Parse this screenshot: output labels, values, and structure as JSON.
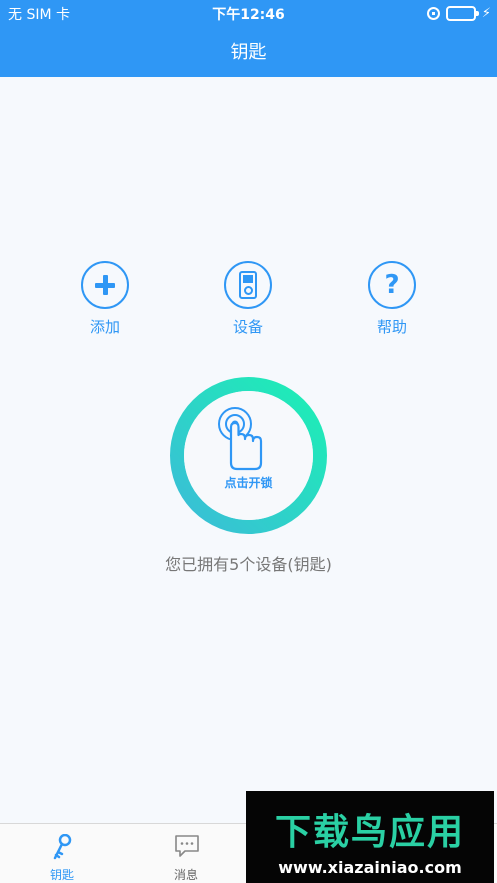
{
  "status_bar": {
    "carrier": "无 SIM 卡",
    "time": "下午12:46",
    "orientation_lock_icon": "orientation-lock-icon",
    "battery_icon": "battery-icon",
    "charging_icon": "charging-icon",
    "battery_fill_color": "#4cd964",
    "charge_glyph": "⚡"
  },
  "nav": {
    "title": "钥匙"
  },
  "actions": [
    {
      "label": "添加",
      "icon": "plus-icon"
    },
    {
      "label": "设备",
      "icon": "device-icon"
    },
    {
      "label": "帮助",
      "icon": "help-icon",
      "glyph": "?"
    }
  ],
  "unlock": {
    "label": "点击开锁",
    "icon": "finger-tap-icon",
    "gradient_start": "#3bbcd8",
    "gradient_end": "#1cf0b4"
  },
  "owned_text": "您已拥有5个设备(钥匙)",
  "tabs": [
    {
      "label": "钥匙",
      "icon": "key-icon",
      "active": true
    },
    {
      "label": "消息",
      "icon": "message-icon",
      "active": false
    }
  ],
  "watermark": {
    "title": "下载鸟应用",
    "url": "www.xiazainiao.com"
  },
  "colors": {
    "primary": "#2f97f5",
    "background": "#f6f9fd",
    "muted_text": "#777777"
  }
}
